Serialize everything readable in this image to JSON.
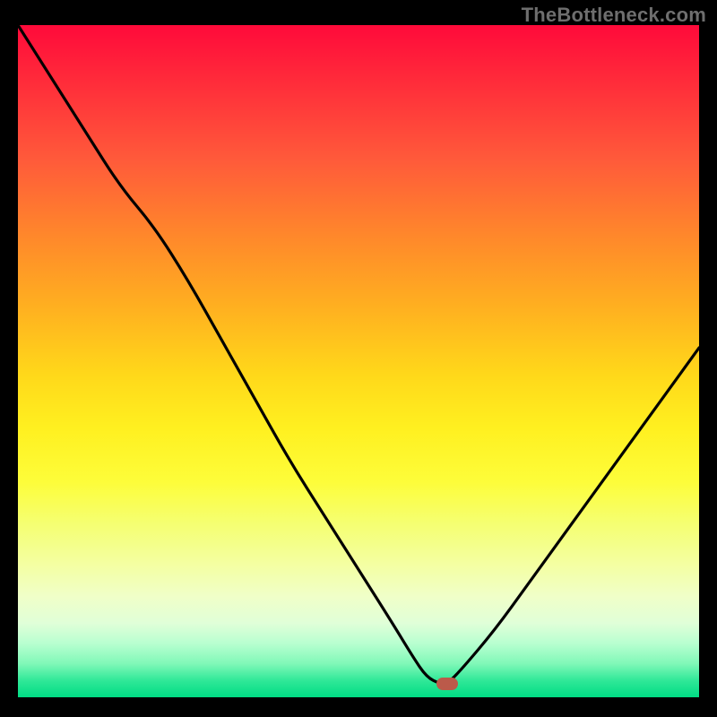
{
  "watermark": "TheBottleneck.com",
  "colors": {
    "frame": "#000000",
    "curve": "#000000",
    "marker": "#bb5a4a",
    "gradient_top": "#ff0a3a",
    "gradient_bottom": "#00dc84"
  },
  "chart_data": {
    "type": "line",
    "title": "",
    "xlabel": "",
    "ylabel": "",
    "xlim": [
      0,
      100
    ],
    "ylim": [
      0,
      100
    ],
    "grid": false,
    "legend": false,
    "optimum": {
      "x": 63,
      "y": 2
    },
    "series": [
      {
        "name": "bottleneck-curve",
        "x": [
          0,
          5,
          10,
          15,
          20,
          25,
          30,
          35,
          40,
          45,
          50,
          55,
          58,
          60,
          62,
          63,
          65,
          70,
          75,
          80,
          85,
          90,
          95,
          100
        ],
        "y": [
          100,
          92,
          84,
          76,
          70,
          62,
          53,
          44,
          35,
          27,
          19,
          11,
          6,
          3,
          2,
          2,
          4,
          10,
          17,
          24,
          31,
          38,
          45,
          52
        ]
      }
    ],
    "annotations": []
  }
}
